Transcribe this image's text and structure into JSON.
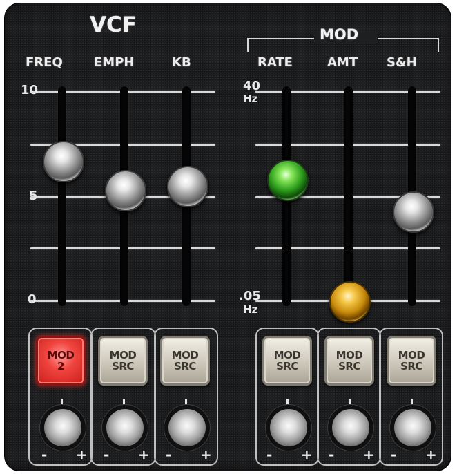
{
  "vcf": {
    "title": "VCF",
    "labels": {
      "freq": "FREQ",
      "emph": "EMPH",
      "kb": "KB"
    },
    "scale": {
      "top": "10",
      "mid": "5",
      "bottom": "0"
    },
    "sliders": {
      "freq": 0.67,
      "emph": 0.53,
      "kb": 0.55
    }
  },
  "mod": {
    "title": "MOD",
    "labels": {
      "rate": "RATE",
      "amt": "AMT",
      "sh": "S&H"
    },
    "scale": {
      "top_value": "40",
      "top_unit": "Hz",
      "bottom_value": ".05",
      "bottom_unit": "Hz"
    },
    "sliders": {
      "rate": 0.58,
      "amt": 0.0,
      "sh": 0.43
    },
    "slider_colors": {
      "rate": "#3fbf2a",
      "amt": "#e2a517"
    }
  },
  "buttons": [
    {
      "line1": "MOD",
      "line2": "2",
      "active": true
    },
    {
      "line1": "MOD",
      "line2": "SRC",
      "active": false
    },
    {
      "line1": "MOD",
      "line2": "SRC",
      "active": false
    },
    {
      "line1": "MOD",
      "line2": "SRC",
      "active": false
    },
    {
      "line1": "MOD",
      "line2": "SRC",
      "active": false
    },
    {
      "line1": "MOD",
      "line2": "SRC",
      "active": false
    }
  ],
  "knob": {
    "minus": "-",
    "plus": "+"
  },
  "colors": {
    "panel": "#1e1f21",
    "active_button": "#e8322c",
    "button_beige": "#d4cfc2",
    "line": "#d9d9d9"
  }
}
